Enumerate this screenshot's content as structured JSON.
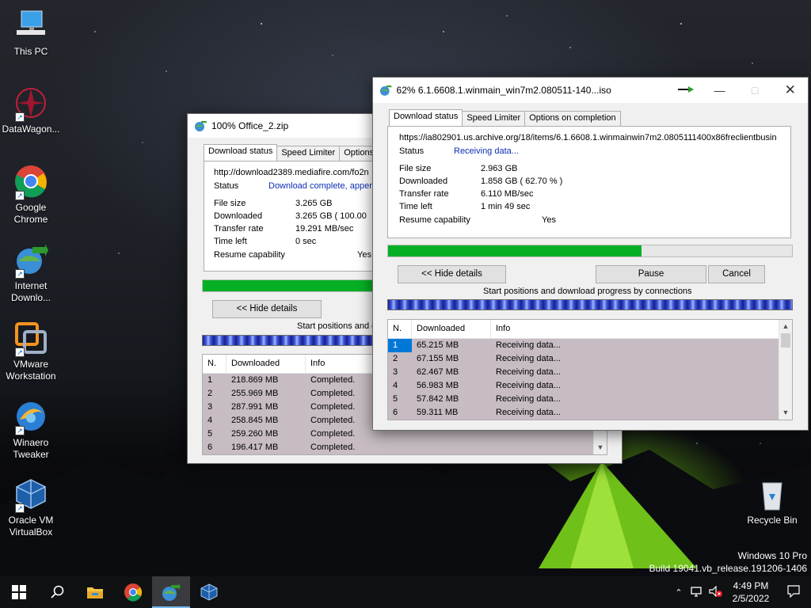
{
  "desktop": {
    "icons": [
      {
        "label": "This PC"
      },
      {
        "label": "DataWagon..."
      },
      {
        "label": "Google Chrome"
      },
      {
        "label": "Internet Downlo..."
      },
      {
        "label": "VMware Workstation"
      },
      {
        "label": "Winaero Tweaker"
      },
      {
        "label": "Oracle VM VirtualBox"
      },
      {
        "label": "Recycle Bin"
      }
    ],
    "watermark": {
      "line1": "Windows 10 Pro",
      "line2": "Build 19041.vb_release.191206-1406"
    }
  },
  "window_back": {
    "title": "100% Office_2.zip",
    "tabs": [
      "Download status",
      "Speed Limiter",
      "Options"
    ],
    "url": "http://download2389.mediafire.com/fo2n",
    "status_label": "Status",
    "status_value": "Download complete, appen",
    "rows": [
      {
        "label": "File size",
        "value": "3.265  GB"
      },
      {
        "label": "Downloaded",
        "value": "3.265  GB  ( 100.00"
      },
      {
        "label": "Transfer rate",
        "value": "19.291  MB/sec"
      },
      {
        "label": "Time left",
        "value": "0 sec"
      },
      {
        "label": "Resume capability",
        "value": "Yes"
      }
    ],
    "progress_percent": 100,
    "hide_details_label": "<< Hide details",
    "connections_label": "Start positions and d",
    "table": {
      "headers": [
        "N.",
        "Downloaded",
        "Info"
      ],
      "rows": [
        {
          "n": "1",
          "downloaded": "218.869  MB",
          "info": "Completed."
        },
        {
          "n": "2",
          "downloaded": "255.969  MB",
          "info": "Completed."
        },
        {
          "n": "3",
          "downloaded": "287.991  MB",
          "info": "Completed."
        },
        {
          "n": "4",
          "downloaded": "258.845  MB",
          "info": "Completed."
        },
        {
          "n": "5",
          "downloaded": "259.260  MB",
          "info": "Completed."
        },
        {
          "n": "6",
          "downloaded": "196.417  MB",
          "info": "Completed."
        }
      ]
    }
  },
  "window_front": {
    "title": "62% 6.1.6608.1.winmain_win7m2.080511-140...iso",
    "tabs": [
      "Download status",
      "Speed Limiter",
      "Options on completion"
    ],
    "url": "https://ia802901.us.archive.org/18/items/6.1.6608.1.winmainwin7m2.0805111400x86freclientbusin",
    "status_label": "Status",
    "status_value": "Receiving data...",
    "rows": [
      {
        "label": "File size",
        "value": "2.963  GB"
      },
      {
        "label": "Downloaded",
        "value": "1.858  GB  ( 62.70 % )"
      },
      {
        "label": "Transfer rate",
        "value": "6.110  MB/sec"
      },
      {
        "label": "Time left",
        "value": "1 min 49 sec"
      },
      {
        "label": "Resume capability",
        "value": "Yes"
      }
    ],
    "progress_percent": 62.7,
    "hide_details_label": "<< Hide details",
    "pause_label": "Pause",
    "cancel_label": "Cancel",
    "connections_label": "Start positions and download progress by connections",
    "table": {
      "headers": [
        "N.",
        "Downloaded",
        "Info"
      ],
      "rows": [
        {
          "n": "1",
          "downloaded": "65.215  MB",
          "info": "Receiving data..."
        },
        {
          "n": "2",
          "downloaded": "67.155  MB",
          "info": "Receiving data..."
        },
        {
          "n": "3",
          "downloaded": "62.467  MB",
          "info": "Receiving data..."
        },
        {
          "n": "4",
          "downloaded": "56.983  MB",
          "info": "Receiving data..."
        },
        {
          "n": "5",
          "downloaded": "57.842  MB",
          "info": "Receiving data..."
        },
        {
          "n": "6",
          "downloaded": "59.311  MB",
          "info": "Receiving data..."
        }
      ]
    }
  },
  "taskbar": {
    "items": [
      "windows-start-icon",
      "search-icon",
      "file-explorer-icon",
      "chrome-icon",
      "internet-download-manager-icon",
      "virtualbox-icon"
    ],
    "clock_time": "4:49 PM",
    "clock_date": "2/5/2022"
  },
  "colors": {
    "progress_green": "#06b025",
    "status_blue": "#0d2fb5",
    "row_bg": "#c7bcc4",
    "selection": "#0078d7"
  }
}
